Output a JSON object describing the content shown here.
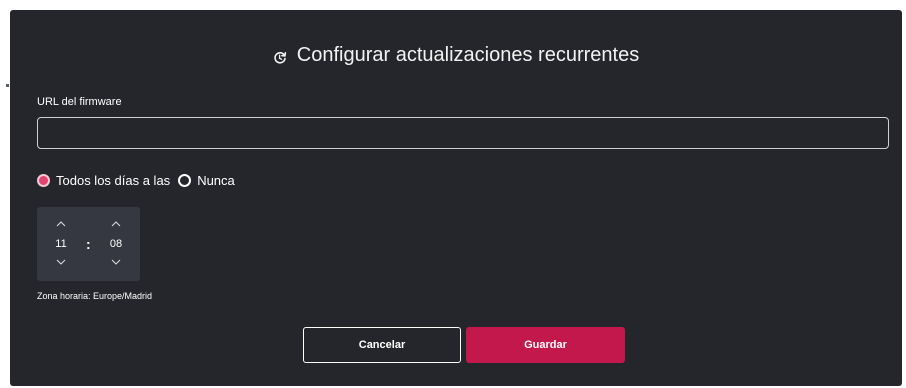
{
  "dialog": {
    "title": "Configurar actualizaciones recurrentes",
    "title_icon": "refresh-clock-icon"
  },
  "form": {
    "url_label": "URL del firmware",
    "url_value": "",
    "url_placeholder": ""
  },
  "schedule": {
    "options": [
      {
        "label": "Todos los días a las",
        "checked": true
      },
      {
        "label": "Nunca",
        "checked": false
      }
    ],
    "hour": "11",
    "minute": "08",
    "separator": ":",
    "timezone_label": "Zona horaria: Europe/Madrid"
  },
  "actions": {
    "cancel_label": "Cancelar",
    "save_label": "Guardar"
  },
  "colors": {
    "background": "#24262b",
    "accent": "#c2184b",
    "radio_checked": "#e0436c",
    "time_picker_bg": "#353840"
  }
}
